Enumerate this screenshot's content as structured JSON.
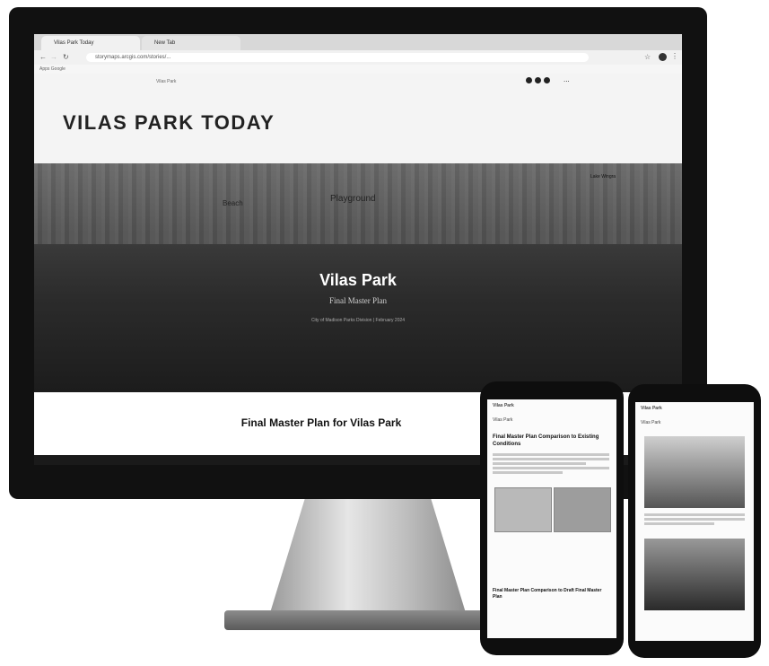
{
  "browser": {
    "tabs": [
      "Vilas Park Today",
      "New Tab"
    ],
    "url": "storymaps.arcgis.com/stories/...",
    "bookmarks": "Apps   Google"
  },
  "site": {
    "nav_label": "Vilas Park",
    "title": "VILAS PARK TODAY",
    "more_icon": "..."
  },
  "hero": {
    "title": "Vilas Park",
    "subtitle": "Final Master Plan",
    "byline": "City of Madison Parks Division | February 2024",
    "map_labels": [
      "Playground",
      "Lake Wingra",
      "Beach"
    ]
  },
  "section": {
    "heading": "Final Master Plan for Vilas Park"
  },
  "phone_left": {
    "header": "Vilas Park",
    "section_label": "Vilas Park",
    "article_title": "Final Master Plan Comparison to Existing Conditions",
    "article_title_2": "Final Master Plan Comparison to Draft Final Master Plan"
  },
  "phone_right": {
    "header": "Vilas Park",
    "section_label": "Vilas Park"
  },
  "icons": [
    "facebook-icon",
    "twitter-icon",
    "link-icon",
    "more-icon"
  ]
}
